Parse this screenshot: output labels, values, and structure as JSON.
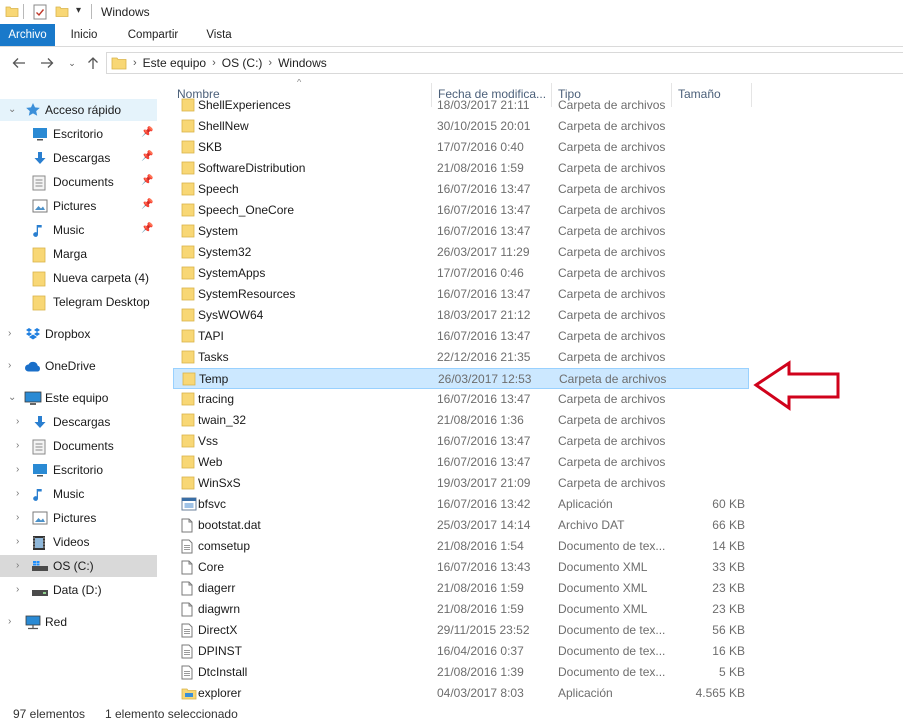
{
  "window": {
    "title": "Windows"
  },
  "ribbon": {
    "tabs": [
      "Archivo",
      "Inicio",
      "Compartir",
      "Vista"
    ]
  },
  "address": {
    "crumbs": [
      "Este equipo",
      "OS (C:)",
      "Windows"
    ]
  },
  "columns": {
    "name": "Nombre",
    "date": "Fecha de modifica...",
    "type": "Tipo",
    "size": "Tamaño"
  },
  "sidebar": {
    "quick_access": "Acceso rápido",
    "quick_items": [
      "Escritorio",
      "Descargas",
      "Documents",
      "Pictures",
      "Music",
      "Marga",
      "Nueva carpeta (4)",
      "Telegram Desktop"
    ],
    "dropbox": "Dropbox",
    "onedrive": "OneDrive",
    "this_pc": "Este equipo",
    "pc_items": [
      "Descargas",
      "Documents",
      "Escritorio",
      "Music",
      "Pictures",
      "Videos",
      "OS (C:)",
      "Data (D:)"
    ],
    "network": "Red"
  },
  "partial_row": {
    "name": "ShellExperiences",
    "date": "18/03/2017 21:11",
    "type": "Carpeta de archivos"
  },
  "files": [
    {
      "name": "ShellNew",
      "date": "30/10/2015 20:01",
      "type": "Carpeta de archivos",
      "size": "",
      "icon": "folder-icon"
    },
    {
      "name": "SKB",
      "date": "17/07/2016 0:40",
      "type": "Carpeta de archivos",
      "size": "",
      "icon": "folder-icon"
    },
    {
      "name": "SoftwareDistribution",
      "date": "21/08/2016 1:59",
      "type": "Carpeta de archivos",
      "size": "",
      "icon": "folder-icon"
    },
    {
      "name": "Speech",
      "date": "16/07/2016 13:47",
      "type": "Carpeta de archivos",
      "size": "",
      "icon": "folder-icon"
    },
    {
      "name": "Speech_OneCore",
      "date": "16/07/2016 13:47",
      "type": "Carpeta de archivos",
      "size": "",
      "icon": "folder-icon"
    },
    {
      "name": "System",
      "date": "16/07/2016 13:47",
      "type": "Carpeta de archivos",
      "size": "",
      "icon": "folder-icon"
    },
    {
      "name": "System32",
      "date": "26/03/2017 11:29",
      "type": "Carpeta de archivos",
      "size": "",
      "icon": "folder-icon"
    },
    {
      "name": "SystemApps",
      "date": "17/07/2016 0:46",
      "type": "Carpeta de archivos",
      "size": "",
      "icon": "folder-icon"
    },
    {
      "name": "SystemResources",
      "date": "16/07/2016 13:47",
      "type": "Carpeta de archivos",
      "size": "",
      "icon": "folder-icon"
    },
    {
      "name": "SysWOW64",
      "date": "18/03/2017 21:12",
      "type": "Carpeta de archivos",
      "size": "",
      "icon": "folder-icon"
    },
    {
      "name": "TAPI",
      "date": "16/07/2016 13:47",
      "type": "Carpeta de archivos",
      "size": "",
      "icon": "folder-icon"
    },
    {
      "name": "Tasks",
      "date": "22/12/2016 21:35",
      "type": "Carpeta de archivos",
      "size": "",
      "icon": "folder-icon"
    },
    {
      "name": "Temp",
      "date": "26/03/2017 12:53",
      "type": "Carpeta de archivos",
      "size": "",
      "icon": "folder-icon",
      "selected": true
    },
    {
      "name": "tracing",
      "date": "16/07/2016 13:47",
      "type": "Carpeta de archivos",
      "size": "",
      "icon": "folder-icon"
    },
    {
      "name": "twain_32",
      "date": "21/08/2016 1:36",
      "type": "Carpeta de archivos",
      "size": "",
      "icon": "folder-icon"
    },
    {
      "name": "Vss",
      "date": "16/07/2016 13:47",
      "type": "Carpeta de archivos",
      "size": "",
      "icon": "folder-icon"
    },
    {
      "name": "Web",
      "date": "16/07/2016 13:47",
      "type": "Carpeta de archivos",
      "size": "",
      "icon": "folder-icon"
    },
    {
      "name": "WinSxS",
      "date": "19/03/2017 21:09",
      "type": "Carpeta de archivos",
      "size": "",
      "icon": "folder-icon"
    },
    {
      "name": "bfsvc",
      "date": "16/07/2016 13:42",
      "type": "Aplicación",
      "size": "60 KB",
      "icon": "application-icon"
    },
    {
      "name": "bootstat.dat",
      "date": "25/03/2017 14:14",
      "type": "Archivo DAT",
      "size": "66 KB",
      "icon": "file-icon"
    },
    {
      "name": "comsetup",
      "date": "21/08/2016 1:54",
      "type": "Documento de tex...",
      "size": "14 KB",
      "icon": "text-document-icon"
    },
    {
      "name": "Core",
      "date": "16/07/2016 13:43",
      "type": "Documento XML",
      "size": "33 KB",
      "icon": "file-icon"
    },
    {
      "name": "diagerr",
      "date": "21/08/2016 1:59",
      "type": "Documento XML",
      "size": "23 KB",
      "icon": "file-icon"
    },
    {
      "name": "diagwrn",
      "date": "21/08/2016 1:59",
      "type": "Documento XML",
      "size": "23 KB",
      "icon": "file-icon"
    },
    {
      "name": "DirectX",
      "date": "29/11/2015 23:52",
      "type": "Documento de tex...",
      "size": "56 KB",
      "icon": "text-document-icon"
    },
    {
      "name": "DPINST",
      "date": "16/04/2016 0:37",
      "type": "Documento de tex...",
      "size": "16 KB",
      "icon": "text-document-icon"
    },
    {
      "name": "DtcInstall",
      "date": "21/08/2016 1:39",
      "type": "Documento de tex...",
      "size": "5 KB",
      "icon": "text-document-icon"
    },
    {
      "name": "explorer",
      "date": "04/03/2017 8:03",
      "type": "Aplicación",
      "size": "4.565 KB",
      "icon": "explorer-app-icon"
    }
  ],
  "status": {
    "count": "97 elementos",
    "selection": "1 elemento seleccionado"
  },
  "colors": {
    "accent": "#1979ca",
    "selection_fill": "#cce8ff",
    "selection_border": "#99d1ff",
    "arrow": "#d0021b",
    "folder": "#f8d775"
  }
}
